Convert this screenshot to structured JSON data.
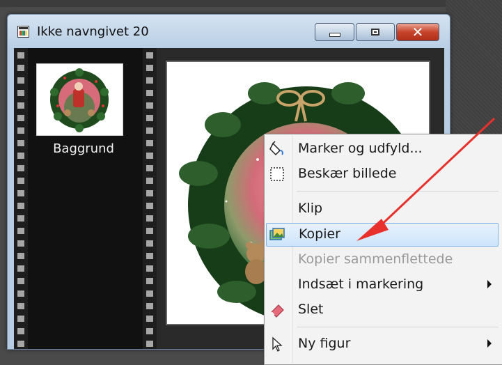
{
  "window": {
    "title": "Ikke navngivet 20",
    "buttons": {
      "minimize": "minimize",
      "maximize": "maximize",
      "close": "✕"
    }
  },
  "layers_panel": {
    "layer_name": "Baggrund"
  },
  "context_menu": {
    "items": [
      {
        "label": "Marker og udfyld...",
        "icon": "fill-select-icon",
        "enabled": true
      },
      {
        "label": "Beskær billede",
        "icon": "crop-icon",
        "enabled": true
      },
      {
        "label": "Klip",
        "icon": "",
        "enabled": true
      },
      {
        "label": "Kopier",
        "icon": "copy-image-icon",
        "enabled": true,
        "highlighted": true
      },
      {
        "label": "Kopier sammenflettede",
        "icon": "",
        "enabled": false
      },
      {
        "label": "Indsæt i markering",
        "icon": "",
        "enabled": true,
        "submenu": true
      },
      {
        "label": "Slet",
        "icon": "eraser-icon",
        "enabled": true
      },
      {
        "label": "Ny figur",
        "icon": "cursor-icon",
        "enabled": true,
        "submenu": true
      }
    ]
  },
  "colors": {
    "highlight": "#cde4fb",
    "arrow": "#e8312c",
    "close_button": "#c8442b"
  }
}
